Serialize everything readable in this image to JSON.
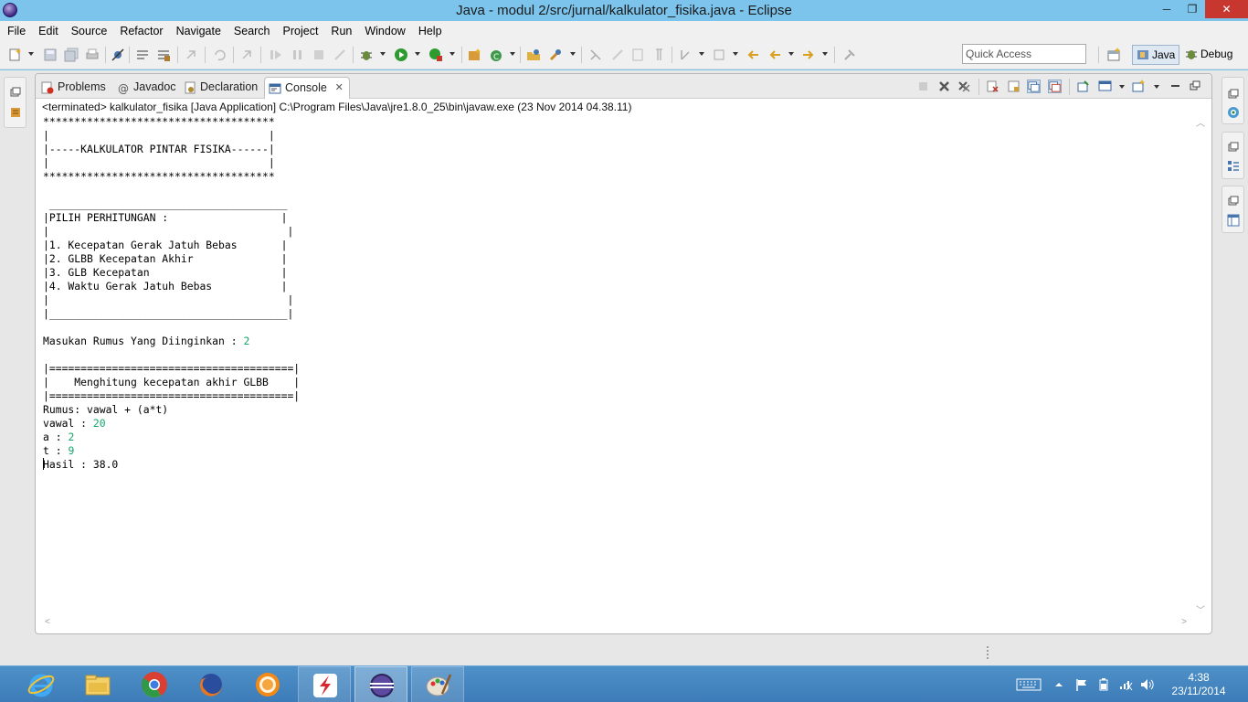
{
  "window": {
    "title": "Java - modul 2/src/jurnal/kalkulator_fisika.java - Eclipse",
    "min_glyph": "─",
    "max_glyph": "❐",
    "close_glyph": "✕"
  },
  "menu": [
    "File",
    "Edit",
    "Source",
    "Refactor",
    "Navigate",
    "Search",
    "Project",
    "Run",
    "Window",
    "Help"
  ],
  "toolbar": {
    "quick_access_placeholder": "Quick Access",
    "perspectives": [
      {
        "label": "Java",
        "icon": "java-perspective-icon",
        "active": true
      },
      {
        "label": "Debug",
        "icon": "debug-perspective-icon",
        "active": false
      }
    ]
  },
  "tabs": [
    {
      "label": "Problems",
      "icon": "problems-icon",
      "active": false
    },
    {
      "label": "Javadoc",
      "icon": "javadoc-icon",
      "active": false
    },
    {
      "label": "Declaration",
      "icon": "declaration-icon",
      "active": false
    },
    {
      "label": "Console",
      "icon": "console-icon",
      "active": true
    }
  ],
  "tab_close_glyph": "✕",
  "console": {
    "status": "<terminated> kalkulator_fisika [Java Application] C:\\Program Files\\Java\\jre1.8.0_25\\bin\\javaw.exe (23 Nov 2014 04.38.11)",
    "lines": [
      {
        "text": "*************************************"
      },
      {
        "text": "|                                   |"
      },
      {
        "text": "|-----KALKULATOR PINTAR FISIKA------|"
      },
      {
        "text": "|                                   |"
      },
      {
        "text": "*************************************"
      },
      {
        "text": ""
      },
      {
        "text": " ______________________________________"
      },
      {
        "text": "|PILIH PERHITUNGAN :                  |"
      },
      {
        "text": "|                                      |"
      },
      {
        "text": "|1. Kecepatan Gerak Jatuh Bebas       |"
      },
      {
        "text": "|2. GLBB Kecepatan Akhir              |"
      },
      {
        "text": "|3. GLB Kecepatan                     |"
      },
      {
        "text": "|4. Waktu Gerak Jatuh Bebas           |"
      },
      {
        "text": "|                                      |"
      },
      {
        "text": "|______________________________________|"
      },
      {
        "text": ""
      },
      {
        "text": "Masukan Rumus Yang Diinginkan : ",
        "input": "2"
      },
      {
        "text": ""
      },
      {
        "text": "|=======================================|"
      },
      {
        "text": "|    Menghitung kecepatan akhir GLBB    |"
      },
      {
        "text": "|=======================================|"
      },
      {
        "text": "Rumus: vawal + (a*t)"
      },
      {
        "text": "vawal : ",
        "input": "20"
      },
      {
        "text": "a : ",
        "input": "2"
      },
      {
        "text": "t : ",
        "input": "9"
      },
      {
        "text": "Hasil : 38.0",
        "caret": true
      }
    ]
  },
  "taskbar": {
    "apps": [
      {
        "name": "internet-explorer",
        "state": "none"
      },
      {
        "name": "file-explorer",
        "state": "none"
      },
      {
        "name": "chrome",
        "state": "none"
      },
      {
        "name": "firefox",
        "state": "none"
      },
      {
        "name": "orb-browser",
        "state": "none"
      },
      {
        "name": "red-app",
        "state": "open"
      },
      {
        "name": "eclipse",
        "state": "active"
      },
      {
        "name": "paint",
        "state": "open"
      }
    ],
    "clock_time": "4:38",
    "clock_date": "23/11/2014"
  }
}
